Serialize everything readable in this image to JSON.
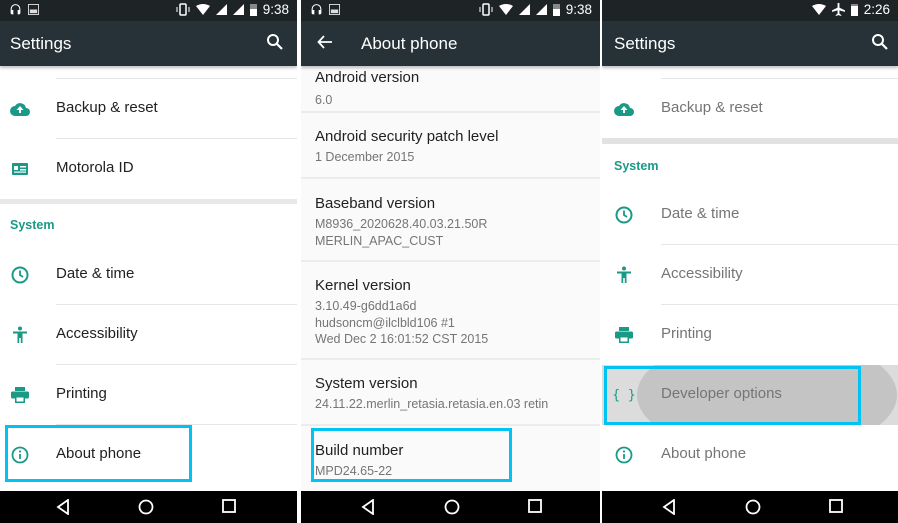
{
  "colors": {
    "accent": "#1a9a86",
    "highlight": "#00c3f3",
    "appbar": "#263238",
    "statusbar": "#1e2326"
  },
  "panel1": {
    "status": {
      "left_icons": [
        "headphones-icon",
        "image-icon"
      ],
      "right_icons": [
        "vibrate-icon",
        "wifi-icon",
        "signal-icon",
        "signal-icon",
        "battery-icon"
      ],
      "time": "9:38"
    },
    "title": "Settings",
    "items_top": [
      {
        "label": "Backup & reset",
        "icon": "cloud-upload-icon"
      },
      {
        "label": "Motorola ID",
        "icon": "id-card-icon"
      }
    ],
    "section": "System",
    "items_system": [
      {
        "label": "Date & time",
        "icon": "clock-icon"
      },
      {
        "label": "Accessibility",
        "icon": "accessibility-icon"
      },
      {
        "label": "Printing",
        "icon": "printer-icon"
      },
      {
        "label": "About phone",
        "icon": "info-icon",
        "highlighted": true
      }
    ]
  },
  "panel2": {
    "status": {
      "time": "9:38"
    },
    "title": "About phone",
    "entries": [
      {
        "title": "Android version",
        "value": "6.0"
      },
      {
        "title": "Android security patch level",
        "value": "1 December 2015"
      },
      {
        "title": "Baseband version",
        "value": "M8936_2020628.40.03.21.50R\nMERLIN_APAC_CUST"
      },
      {
        "title": "Kernel version",
        "value": "3.10.49-g6dd1a6d\nhudsoncm@ilclbld106 #1\nWed Dec 2 16:01:52 CST 2015"
      },
      {
        "title": "System version",
        "value": "24.11.22.merlin_retasia.retasia.en.03 retin"
      },
      {
        "title": "Build number",
        "value": "MPD24.65-22",
        "highlighted": true
      }
    ]
  },
  "panel3": {
    "status": {
      "right_icons": [
        "wifi-icon",
        "airplane-icon",
        "battery-icon"
      ],
      "time": "2:26"
    },
    "title": "Settings",
    "items_top": [
      {
        "label": "Backup & reset",
        "icon": "cloud-upload-icon"
      }
    ],
    "section": "System",
    "items_system": [
      {
        "label": "Date & time",
        "icon": "clock-icon"
      },
      {
        "label": "Accessibility",
        "icon": "accessibility-icon"
      },
      {
        "label": "Printing",
        "icon": "printer-icon"
      },
      {
        "label": "Developer options",
        "icon": "braces-icon",
        "highlighted": true,
        "pressed": true
      },
      {
        "label": "About phone",
        "icon": "info-icon"
      }
    ],
    "developer_icon_glyph": "{ }"
  },
  "navbar": {
    "buttons": [
      "back-button",
      "home-button",
      "recents-button"
    ]
  }
}
